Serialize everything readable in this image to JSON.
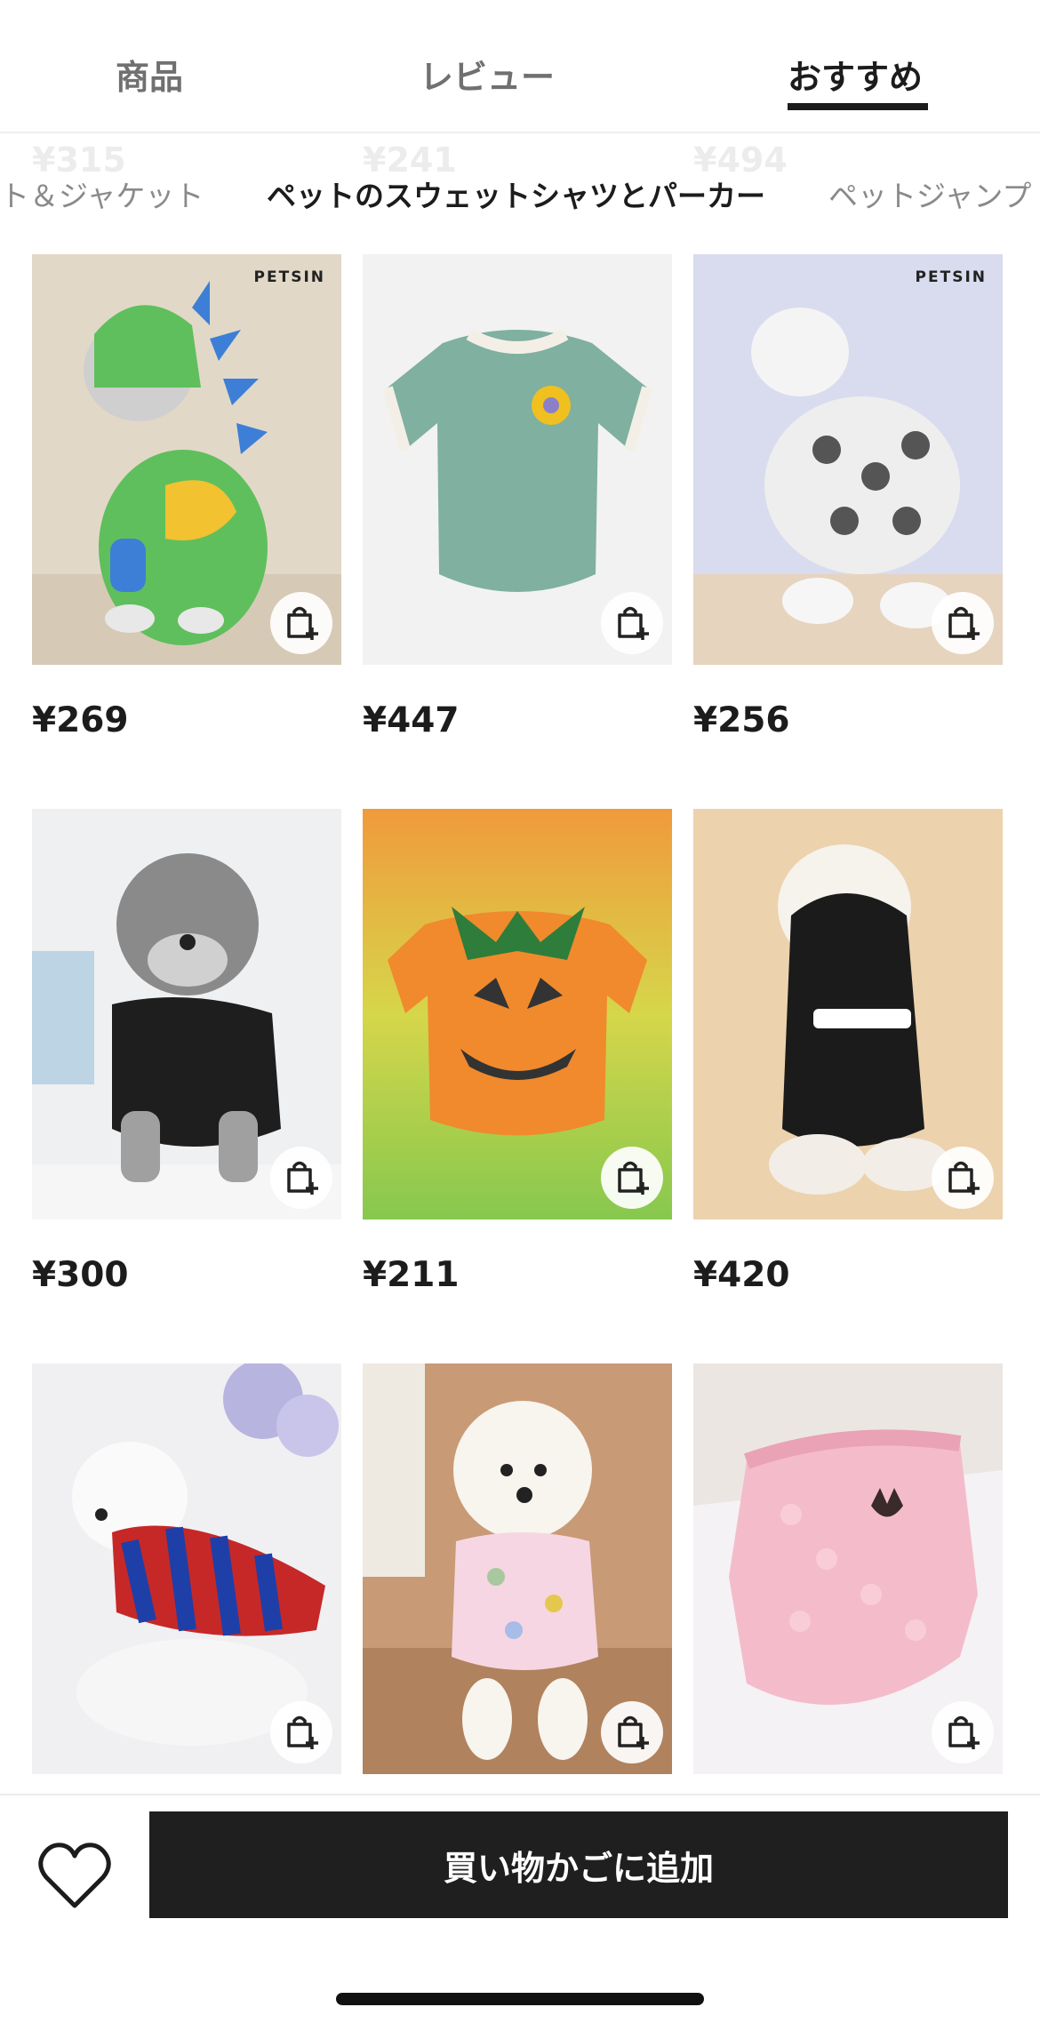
{
  "tabs": [
    {
      "label": "商品"
    },
    {
      "label": "レビュー"
    },
    {
      "label": "おすすめ",
      "active": true
    }
  ],
  "ghost_prices": [
    "¥315",
    "¥241",
    "¥494"
  ],
  "categories": [
    {
      "label": "ト＆ジャケット"
    },
    {
      "label": "ペットのスウェットシャツとパーカー",
      "active": true
    },
    {
      "label": "ペットジャンプ"
    }
  ],
  "products": [
    {
      "price": "¥269",
      "brand": "PETSIN",
      "image": "cat-green-dinosaur-hoodie"
    },
    {
      "price": "¥447",
      "brand": "",
      "image": "teal-fleece-sweater-flower"
    },
    {
      "price": "¥256",
      "brand": "PETSIN",
      "image": "white-dog-panda-print-sweater"
    },
    {
      "price": "¥300",
      "brand": "",
      "image": "schnauzer-black-sweatshirt"
    },
    {
      "price": "¥211",
      "brand": "",
      "image": "orange-pumpkin-sweater"
    },
    {
      "price": "¥420",
      "brand": "",
      "image": "poodle-black-security-hoodie"
    },
    {
      "price": "",
      "brand": "",
      "image": "bichon-striped-sweater"
    },
    {
      "price": "",
      "brand": "",
      "image": "poodle-pastel-sweater"
    },
    {
      "price": "",
      "brand": "",
      "image": "pink-textured-sweater"
    }
  ],
  "bottom_bar": {
    "add_to_cart_label": "買い物かごに追加",
    "favorite_icon": "heart-icon"
  },
  "colors": {
    "primary_dark": "#1f1f1f",
    "muted_text": "#707070",
    "divider": "#eeeeee"
  }
}
